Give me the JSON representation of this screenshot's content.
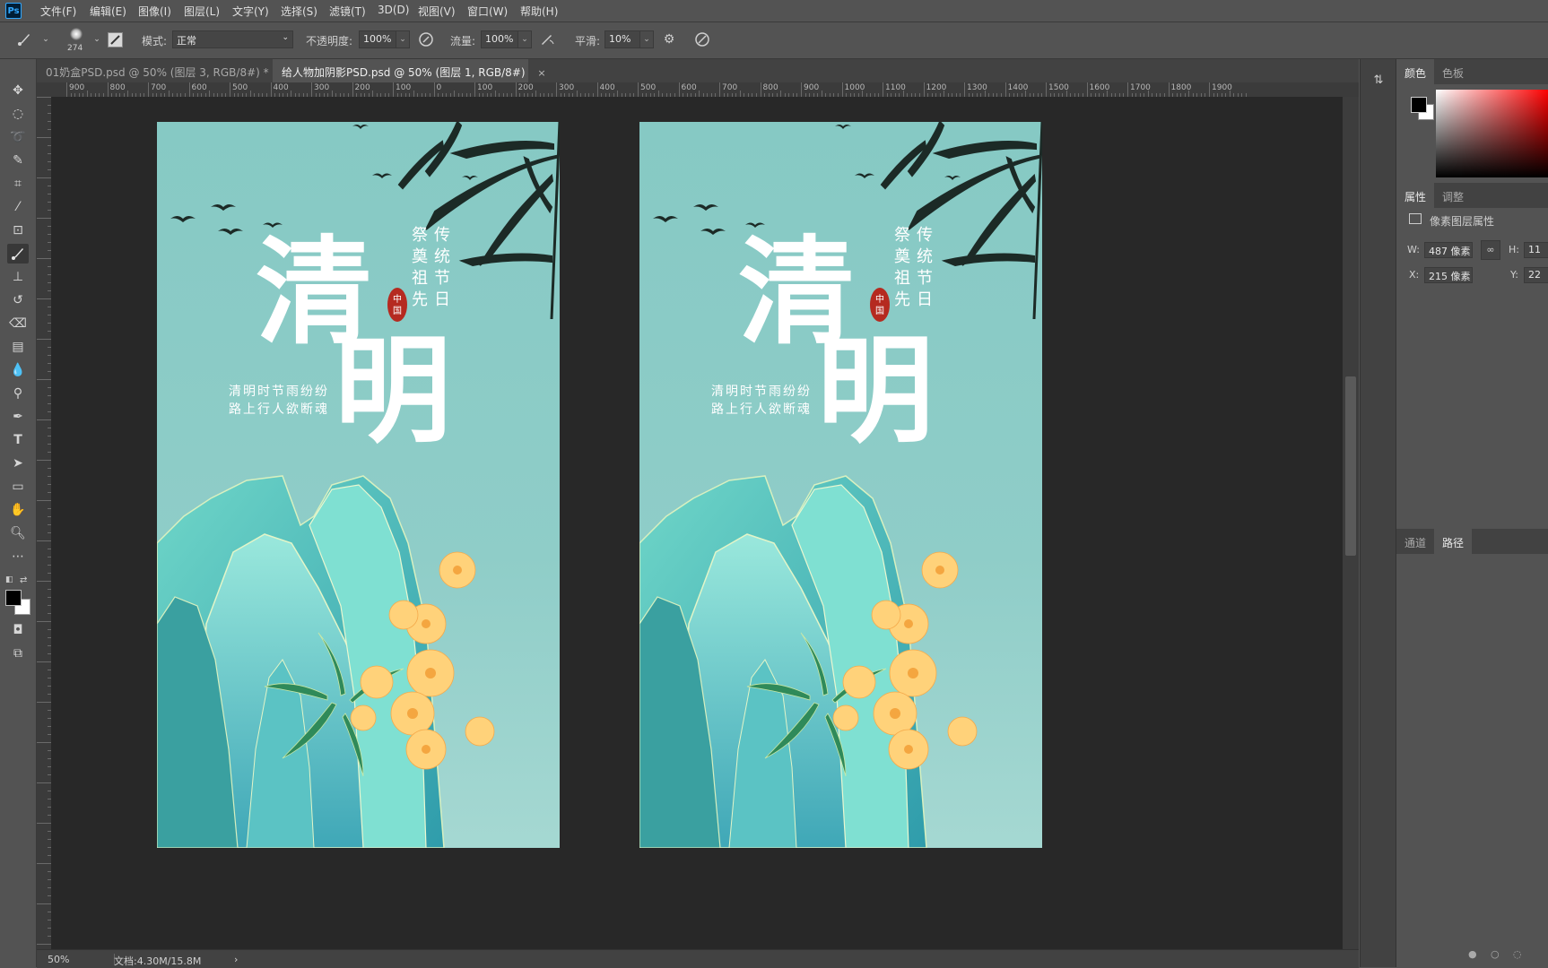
{
  "app": {
    "logo": "Ps"
  },
  "menu": [
    "文件(F)",
    "编辑(E)",
    "图像(I)",
    "图层(L)",
    "文字(Y)",
    "选择(S)",
    "滤镜(T)",
    "3D(D)",
    "视图(V)",
    "窗口(W)",
    "帮助(H)"
  ],
  "options": {
    "brush_size": "274",
    "mode_label": "模式:",
    "mode_value": "正常",
    "opacity_label": "不透明度:",
    "opacity_value": "100%",
    "flow_label": "流量:",
    "flow_value": "100%",
    "smoothing_label": "平滑:",
    "smoothing_value": "10%"
  },
  "tabs": [
    {
      "title": "01奶盒PSD.psd @ 50% (图层 3, RGB/8#) *",
      "close": "×",
      "active": false
    },
    {
      "title": "给人物加阴影PSD.psd @ 50% (图层 1, RGB/8#)",
      "close": "×",
      "active": true
    }
  ],
  "ruler_h": [
    "900",
    "800",
    "700",
    "600",
    "500",
    "400",
    "300",
    "200",
    "100",
    "0",
    "100",
    "200",
    "300",
    "400",
    "500",
    "600",
    "700",
    "800",
    "900",
    "1000",
    "1100",
    "1200",
    "1300",
    "1400",
    "1500",
    "1600",
    "1700",
    "1800",
    "1900"
  ],
  "poster": {
    "title_char_1": "清",
    "title_char_2": "明",
    "vertical_col_1": "传统节日",
    "vertical_col_2": "祭奠祖先",
    "seal": "中国",
    "poem_line_1": "清明时节雨纷纷",
    "poem_line_2": "路上行人欲断魂"
  },
  "status": {
    "zoom": "50%",
    "doc_info": "文档:4.30M/15.8M",
    "arrow": "›"
  },
  "panels": {
    "color_tab": "颜色",
    "swatches_tab": "色板",
    "properties_tab": "属性",
    "adjustments_tab": "调整",
    "pixel_layer_label": "像素图层属性",
    "w_label": "W:",
    "w_value": "487 像素",
    "h_label": "H:",
    "h_value": "11",
    "x_label": "X:",
    "x_value": "215 像素",
    "y_label": "Y:",
    "y_value": "22",
    "channels_tab": "通道",
    "paths_tab": "路径"
  },
  "colors": {
    "foreground": "#000000",
    "background": "#ffffff",
    "poster_bg": "#8fcdc8"
  }
}
